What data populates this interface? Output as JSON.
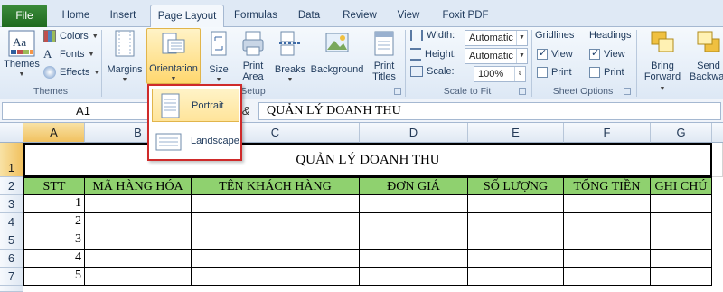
{
  "tabs": {
    "file": "File",
    "items": [
      "Home",
      "Insert",
      "Page Layout",
      "Formulas",
      "Data",
      "Review",
      "View",
      "Foxit PDF"
    ],
    "active_index": 2
  },
  "ribbon": {
    "themes": {
      "themes_label": "Themes",
      "colors_label": "Colors",
      "fonts_label": "Fonts",
      "effects_label": "Effects",
      "group_label": "Themes"
    },
    "page_setup": {
      "margins_label": "Margins",
      "orientation_label": "Orientation",
      "size_label": "Size",
      "print_area_label1": "Print",
      "print_area_label2": "Area",
      "breaks_label": "Breaks",
      "background_label": "Background",
      "print_titles_label1": "Print",
      "print_titles_label2": "Titles",
      "group_label": "Page Setup",
      "group_label_visible": "Setup"
    },
    "scale_to_fit": {
      "width_label": "Width:",
      "width_value": "Automatic",
      "height_label": "Height:",
      "height_value": "Automatic",
      "scale_label": "Scale:",
      "scale_value": "100%",
      "group_label": "Scale to Fit"
    },
    "sheet_options": {
      "gridlines_label": "Gridlines",
      "headings_label": "Headings",
      "view_label": "View",
      "print_label": "Print",
      "gridlines_view": true,
      "gridlines_print": false,
      "headings_view": true,
      "headings_print": false,
      "group_label": "Sheet Options"
    },
    "arrange": {
      "bring_forward_label1": "Bring",
      "bring_forward_label2": "Forward",
      "send_backward_label1": "Send",
      "send_backward_label2": "Backwar"
    }
  },
  "orientation_menu": {
    "items": [
      "Portrait",
      "Landscape"
    ],
    "highlighted_index": 0
  },
  "formula_bar": {
    "name_box": "A1",
    "fx_symbol": "&",
    "formula": "QUẢN LÝ DOANH THU"
  },
  "sheet": {
    "columns": [
      "A",
      "B",
      "C",
      "D",
      "E",
      "F",
      "G"
    ],
    "rows": [
      "1",
      "2",
      "3",
      "4",
      "5",
      "6",
      "7"
    ],
    "title": "QUẢN LÝ DOANH THU",
    "headers": [
      "STT",
      "MÃ HÀNG HÓA",
      "TÊN KHÁCH HÀNG",
      "ĐƠN GIÁ",
      "SỐ LƯỢNG",
      "TỔNG TIỀN",
      "GHI CHÚ"
    ],
    "stt_values": [
      "1",
      "2",
      "3",
      "4",
      "5"
    ],
    "header_fill_color": "#8fd16f",
    "selected_header_color": "#f1c15f"
  }
}
